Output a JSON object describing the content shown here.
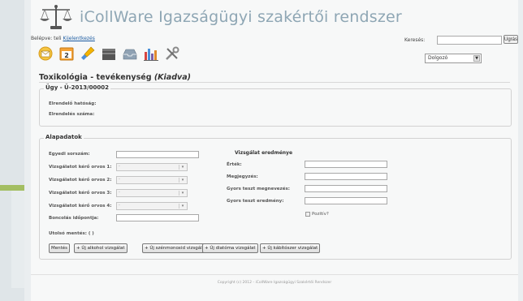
{
  "header": {
    "app_title": "iCollWare Igazságügyi szakértői rendszer",
    "login_prefix": "Belépve: ",
    "user": "teli",
    "logout_label": "Kijelentkezés",
    "search_label": "Keresés:",
    "search_value": "",
    "search_button": "Ugrás"
  },
  "toolbar": {
    "icons": [
      "mail-icon",
      "calendar-icon",
      "brush-icon",
      "folder-icon",
      "inbox-icon",
      "bar-chart-icon",
      "tools-icon"
    ],
    "calendar_number": "2",
    "role_select": "Dolgozó"
  },
  "page": {
    "title": "Toxikológia - tevékenység ",
    "status": "(Kiadva)"
  },
  "case": {
    "legend": "Ügy - Ü-2013/00002",
    "fields": [
      {
        "label": "Elrendelő hatóság:"
      },
      {
        "label": "Elrendelés száma:"
      }
    ]
  },
  "alapadatok": {
    "legend": "Alapadatok",
    "fields": {
      "egyedi": "Egyedi sorszám:",
      "orvos1": "Vizsgálatot kérő orvos 1:",
      "orvos2": "Vizsgálatot kérő orvos 2:",
      "orvos3": "Vizsgálatot kérő orvos 3:",
      "orvos4": "Vizsgálatot kérő orvos 4:",
      "boncolas": "Boncolás időpontja:"
    },
    "select_placeholder": "-",
    "last_save_label": "Utolsó mentés: ( )"
  },
  "eredmeny": {
    "heading": "Vizsgálat eredménye",
    "fields": {
      "ertek": "Érték:",
      "megjegyzes": "Megjegyzés:",
      "gyors_megnevezes": "Gyors teszt megnevezés:",
      "gyors_eredmeny": "Gyors teszt eredmény:"
    },
    "pozitiv": "Pozitív?"
  },
  "buttons": {
    "save": "Mentés",
    "alkohol": "+ Új alkohol vizsgálat",
    "szonmonoxid": "+ Új szénmonoxid vizsgálat",
    "diatoma": "+ Új diatóma vizsgálat",
    "kabitoszer": "+ Új kábítószer vizsgálat"
  },
  "footer": {
    "copyright": "Copyright (c) 2012 - iCollWare Igazságügyi Szakértői Rendszer"
  },
  "colors": {
    "title_blue": "#8ea6b4",
    "link_blue": "#1a5aa0",
    "accent_green": "#a3be62"
  }
}
